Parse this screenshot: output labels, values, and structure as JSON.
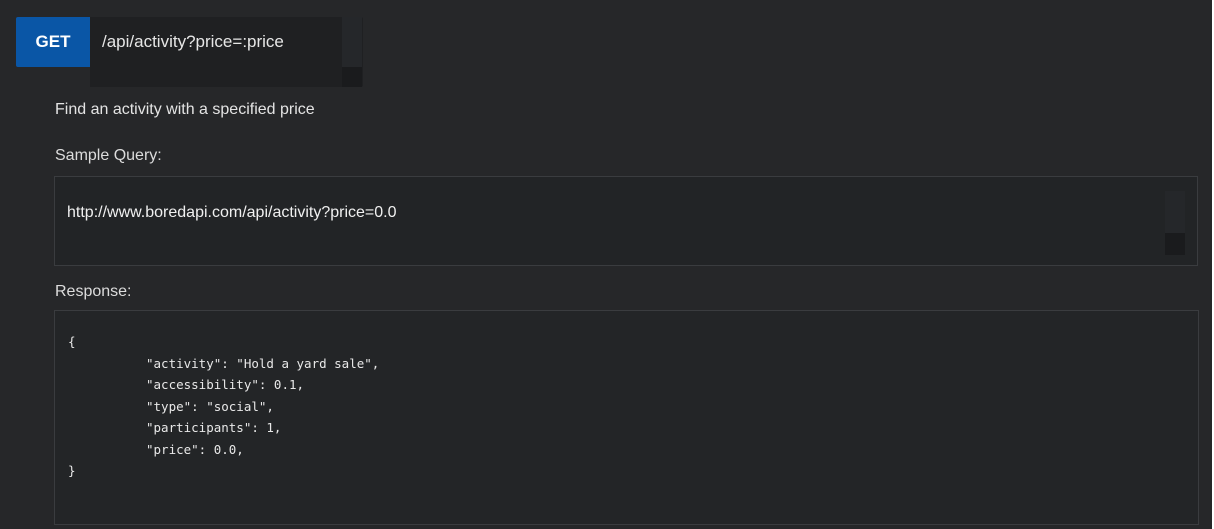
{
  "endpoint": {
    "method": "GET",
    "path": "/api/activity?price=:price"
  },
  "description": "Find an activity with a specified price",
  "sample": {
    "label": "Sample Query:",
    "url": "http://www.boredapi.com/api/activity?price=0.0"
  },
  "response": {
    "label": "Response:",
    "lines": [
      "{",
      "\"activity\": \"Hold a yard sale\",",
      "\"accessibility\": 0.1,",
      "\"type\": \"social\",",
      "\"participants\": 1,",
      "\"price\": 0.0,",
      "}"
    ]
  }
}
